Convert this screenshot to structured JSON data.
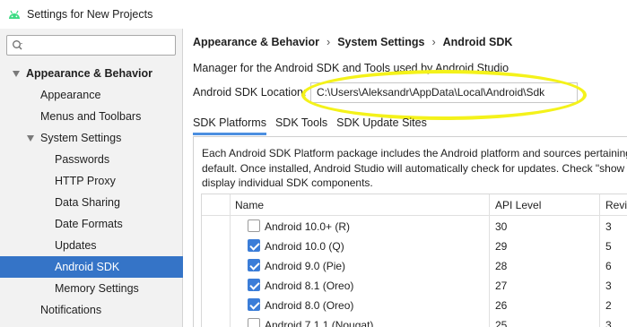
{
  "window": {
    "title": "Settings for New Projects",
    "app_icon": "android-icon",
    "accent_color": "#3574c7"
  },
  "sidebar": {
    "search": {
      "placeholder": "",
      "value": "",
      "icon": "search-icon"
    },
    "items": [
      {
        "label": "Appearance & Behavior",
        "expanded": true,
        "selected": false
      },
      {
        "label": "Appearance",
        "selected": false
      },
      {
        "label": "Menus and Toolbars",
        "selected": false
      },
      {
        "label": "System Settings",
        "expanded": true,
        "selected": false
      },
      {
        "label": "Passwords",
        "selected": false
      },
      {
        "label": "HTTP Proxy",
        "selected": false
      },
      {
        "label": "Data Sharing",
        "selected": false
      },
      {
        "label": "Date Formats",
        "selected": false
      },
      {
        "label": "Updates",
        "selected": false
      },
      {
        "label": "Android SDK",
        "selected": true
      },
      {
        "label": "Memory Settings",
        "selected": false
      },
      {
        "label": "Notifications",
        "selected": false
      }
    ]
  },
  "main": {
    "breadcrumb": [
      "Appearance & Behavior",
      "System Settings",
      "Android SDK"
    ],
    "breadcrumb_separator": "›",
    "description": "Manager for the Android SDK and Tools used by Android Studio",
    "sdk_location": {
      "label": "Android SDK Location:",
      "value": "C:\\Users\\Aleksandr\\AppData\\Local\\Android\\Sdk"
    },
    "highlight_color": "#f4f21a",
    "tabs": [
      {
        "label": "SDK Platforms",
        "active": true
      },
      {
        "label": "SDK Tools",
        "active": false
      },
      {
        "label": "SDK Update Sites",
        "active": false
      }
    ],
    "platform_description": [
      "Each Android SDK Platform package includes the Android platform and sources pertaining",
      "default. Once installed, Android Studio will automatically check for updates. Check \"show",
      "display individual SDK components."
    ],
    "table": {
      "columns": [
        "Name",
        "API Level",
        "Revi"
      ],
      "rows": [
        {
          "name": "Android 10.0+ (R)",
          "api": "30",
          "rev": "3",
          "checked": false
        },
        {
          "name": "Android 10.0 (Q)",
          "api": "29",
          "rev": "5",
          "checked": true
        },
        {
          "name": "Android 9.0 (Pie)",
          "api": "28",
          "rev": "6",
          "checked": true
        },
        {
          "name": "Android 8.1 (Oreo)",
          "api": "27",
          "rev": "3",
          "checked": true
        },
        {
          "name": "Android 8.0 (Oreo)",
          "api": "26",
          "rev": "2",
          "checked": true
        },
        {
          "name": "Android 7.1.1 (Nougat)",
          "api": "25",
          "rev": "3",
          "checked": false
        }
      ]
    }
  }
}
